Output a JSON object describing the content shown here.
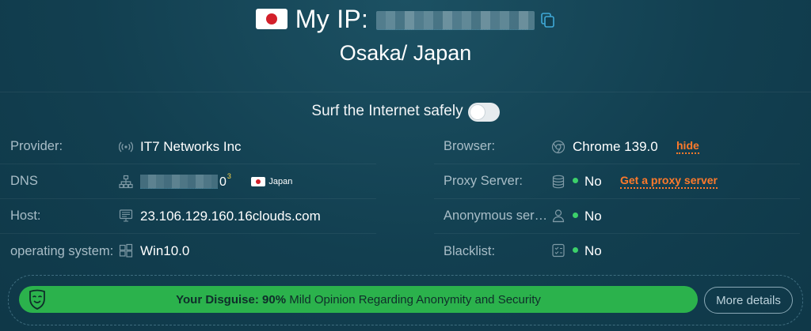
{
  "header": {
    "flag": "japan-flag",
    "ip_label": "My IP:",
    "ip_value": "██████████",
    "city": "Osaka/ Japan"
  },
  "surf": {
    "label": "Surf the Internet safely",
    "enabled": false
  },
  "left_info": [
    {
      "label": "Provider:",
      "icon": "signal-icon",
      "value": "IT7 Networks Inc"
    },
    {
      "label": "DNS",
      "icon": "network-icon",
      "value_tail": "0",
      "superscript": "3",
      "country": "Japan"
    },
    {
      "label": "Host:",
      "icon": "monitor-icon",
      "value": "23.106.129.160.16clouds.com"
    },
    {
      "label": "operating system:",
      "icon": "windows-icon",
      "value": "Win10.0"
    }
  ],
  "right_info": [
    {
      "label": "Browser:",
      "icon": "chrome-icon",
      "value": "Chrome 139.0",
      "link": "hide"
    },
    {
      "label": "Proxy Server:",
      "icon": "database-icon",
      "value": "No",
      "link": "Get a proxy server"
    },
    {
      "label": "Anonymous server:",
      "icon": "user-icon",
      "value": "No"
    },
    {
      "label": "Blacklist:",
      "icon": "checklist-icon",
      "value": "No"
    }
  ],
  "banner": {
    "prefix": "Your Disguise: 90%",
    "text": " Mild Opinion Regarding Anonymity and Security",
    "disguise_percent": 90,
    "button": "More details"
  },
  "colors": {
    "background": "#123f50",
    "accent_green": "#2bb24c",
    "link_orange": "#ff7a2b",
    "status_dot": "#3cd06a"
  }
}
